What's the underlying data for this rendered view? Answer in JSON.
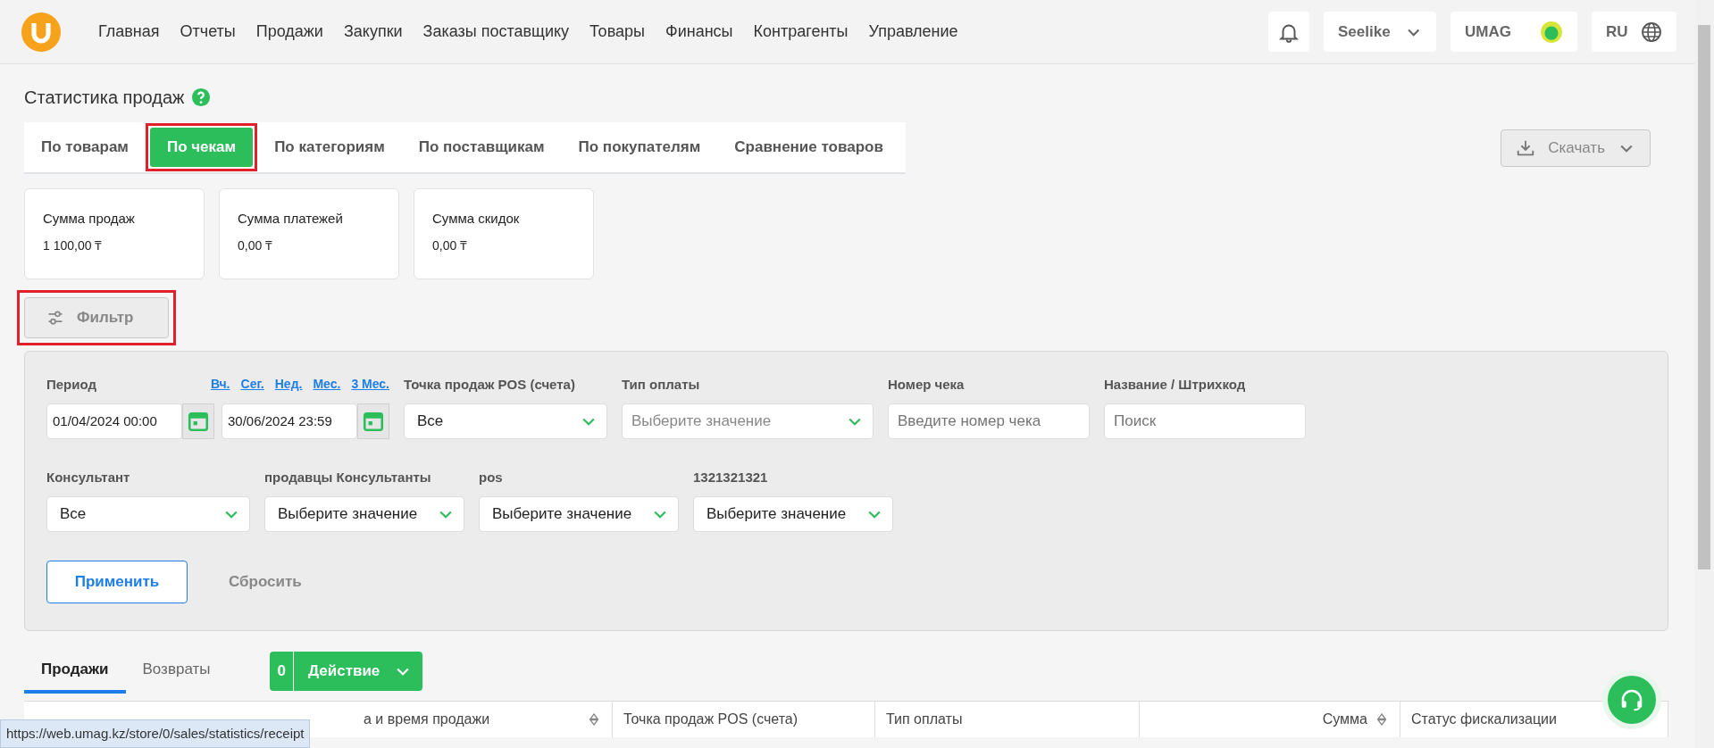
{
  "nav": {
    "items": [
      "Главная",
      "Отчеты",
      "Продажи",
      "Закупки",
      "Заказы поставщику",
      "Товары",
      "Финансы",
      "Контрагенты",
      "Управление"
    ],
    "company": "Seelike",
    "user": "UMAG",
    "language": "RU"
  },
  "page_title": "Статистика продаж",
  "tabs": [
    {
      "label": "По товарам",
      "selected": false,
      "highlighted": false
    },
    {
      "label": "По чекам",
      "selected": true,
      "highlighted": true
    },
    {
      "label": "По категориям",
      "selected": false,
      "highlighted": false
    },
    {
      "label": "По поставщикам",
      "selected": false,
      "highlighted": false
    },
    {
      "label": "По покупателям",
      "selected": false,
      "highlighted": false
    },
    {
      "label": "Сравнение товаров",
      "selected": false,
      "highlighted": false
    }
  ],
  "download_button": "Скачать",
  "summary_cards": [
    {
      "label": "Сумма продаж",
      "value": "1 100,00 ₸"
    },
    {
      "label": "Сумма платежей",
      "value": "0,00 ₸"
    },
    {
      "label": "Сумма скидок",
      "value": "0,00 ₸"
    }
  ],
  "filter_button": {
    "label": "Фильтр",
    "highlighted": true
  },
  "filters": {
    "period": {
      "label": "Период",
      "shortcuts": [
        "Вч.",
        "Сег.",
        "Нед.",
        "Мес.",
        "3 Мес."
      ],
      "from": "01/04/2024 00:00",
      "to": "30/06/2024 23:59"
    },
    "row1": [
      {
        "kind": "select",
        "label": "Точка продаж POS (счета)",
        "value": "Все"
      },
      {
        "kind": "select",
        "label": "Тип оплаты",
        "placeholder": "Выберите значение"
      },
      {
        "kind": "input",
        "label": "Номер чека",
        "placeholder": "Введите номер чека"
      },
      {
        "kind": "input",
        "label": "Название / Штрихкод",
        "placeholder": "Поиск"
      }
    ],
    "row2": [
      {
        "kind": "select",
        "label": "Консультант",
        "value": "Все"
      },
      {
        "kind": "select",
        "label": "продавцы Консультанты",
        "value": "Выберите значение"
      },
      {
        "kind": "select",
        "label": "pos",
        "value": "Выберите значение"
      },
      {
        "kind": "select",
        "label": "1321321321",
        "value": "Выберите значение"
      }
    ],
    "apply_button": "Применить",
    "reset_button": "Сбросить"
  },
  "list_tabs": [
    {
      "label": "Продажи",
      "selected": true
    },
    {
      "label": "Возвраты",
      "selected": false
    }
  ],
  "action_button": {
    "count": "0",
    "label": "Действие"
  },
  "table": {
    "columns": [
      "а и время продажи",
      "Точка продаж POS (счета)",
      "Тип оплаты",
      "Сумма",
      "Статус фискализации"
    ]
  },
  "status_url": "https://web.umag.kz/store/0/sales/statistics/receipt"
}
